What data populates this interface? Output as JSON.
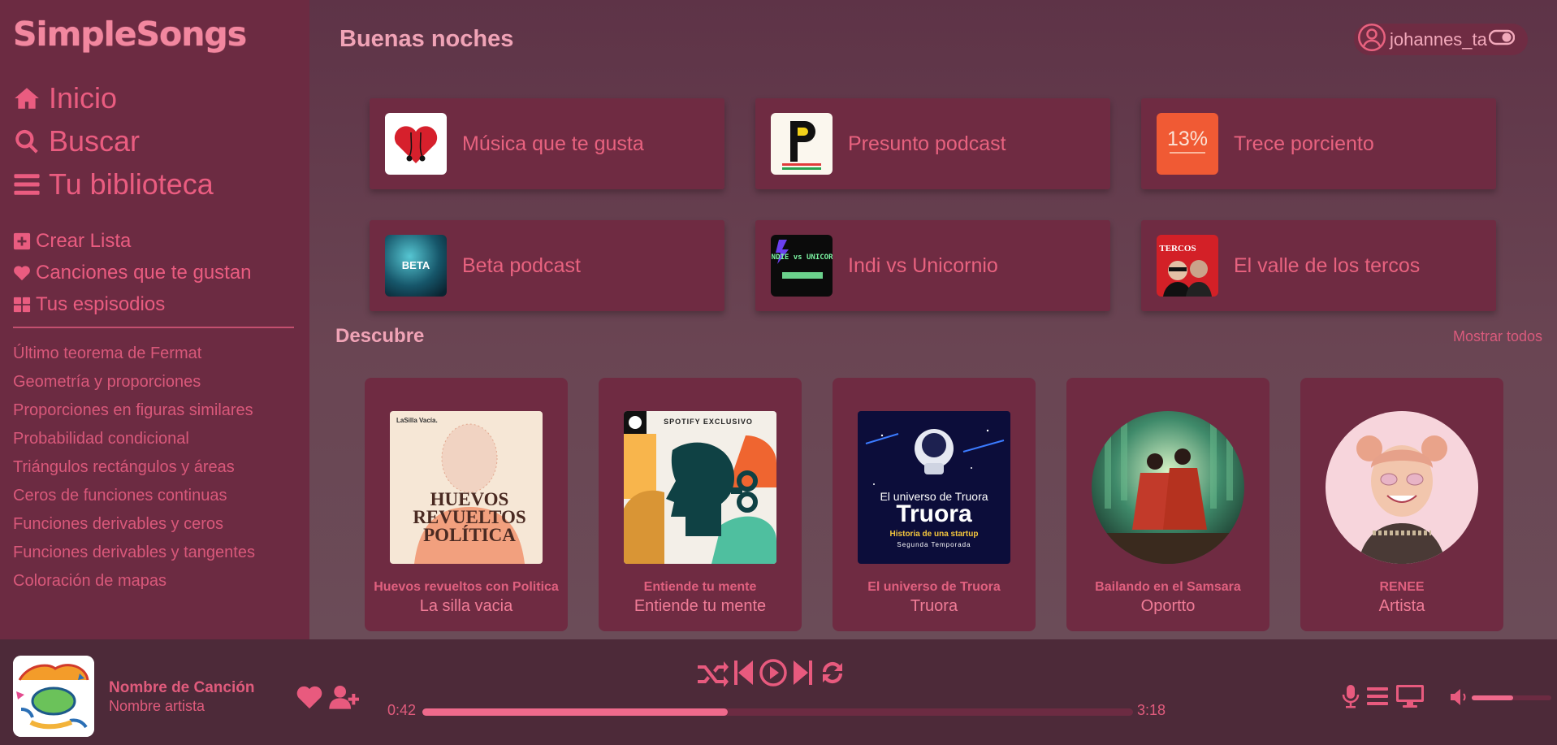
{
  "app": {
    "name": "SimpleSongs"
  },
  "sidebar": {
    "nav": [
      {
        "label": "Inicio",
        "icon": "home-icon"
      },
      {
        "label": "Buscar",
        "icon": "search-icon"
      },
      {
        "label": "Tu biblioteca",
        "icon": "library-icon"
      }
    ],
    "actions": [
      {
        "label": "Crear Lista",
        "icon": "plus-square-icon"
      },
      {
        "label": "Canciones que te gustan",
        "icon": "heart-icon"
      },
      {
        "label": "Tus espisodios",
        "icon": "grid-icon"
      }
    ],
    "playlists": [
      "Último teorema de Fermat",
      "Geometría y proporciones",
      "Proporciones en figuras similares",
      "Probabilidad condicional",
      "Triángulos rectángulos y áreas",
      "Ceros de funciones continuas",
      "Funciones derivables y ceros",
      "Funciones derivables y tangentes",
      "Coloración de mapas"
    ]
  },
  "header": {
    "greeting": "Buenas noches",
    "username": "johannes_ta"
  },
  "quick_access": [
    {
      "label": "Música que te gusta"
    },
    {
      "label": "Presunto podcast"
    },
    {
      "label": "Trece porciento",
      "thumb_text": "13%"
    },
    {
      "label": "Beta podcast",
      "thumb_text": "BETA"
    },
    {
      "label": "Indi vs Unicornio",
      "thumb_text": "INDIE vs UNICORNIO"
    },
    {
      "label": "El valle de los tercos",
      "thumb_text": "TERCOS"
    }
  ],
  "discover": {
    "title": "Descubre",
    "show_all": "Mostrar todos",
    "cards": [
      {
        "subtitle": "Huevos revueltos con Politica",
        "title": "La silla vacia",
        "art_text": "HUEVOS REVUELTOS POLÍTICA",
        "art_brand": "LaSilla Vacía."
      },
      {
        "subtitle": "Entiende tu mente",
        "title": "Entiende tu mente",
        "art_text": "SPOTIFY EXCLUSIVO"
      },
      {
        "subtitle": "El universo de Truora",
        "title": "Truora",
        "art_text": "El universo de Truora",
        "art_line2": "Historia de una startup",
        "art_line3": "Segunda Temporada"
      },
      {
        "subtitle": "Bailando en el Samsara",
        "title": "Oportto"
      },
      {
        "subtitle": "RENEE",
        "title": "Artista"
      }
    ]
  },
  "player": {
    "track_title": "Nombre de Canción",
    "track_artist": "Nombre artista",
    "current_time": "0:42",
    "total_time": "3:18",
    "progress_fraction": 0.43,
    "volume_fraction": 0.52
  },
  "colors": {
    "accent": "#e85a7e",
    "sidebar_bg": "#6c2b42",
    "main_bg": "#5e3347",
    "player_bg": "#4d2a39",
    "heading": "#f0a3b6"
  }
}
